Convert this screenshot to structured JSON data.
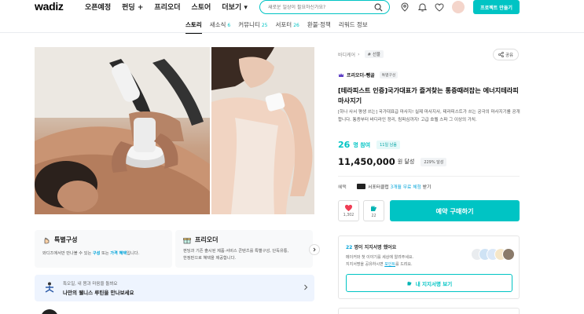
{
  "header": {
    "logo": "wadiz",
    "nav": [
      "오픈예정",
      "펀딩 +",
      "프리오더",
      "스토어",
      "더보기"
    ],
    "search_placeholder": "새로운 일상이 필요하신가요?",
    "project_button": "프로젝트 만들기",
    "icons": [
      "search-icon",
      "location-icon",
      "bell-icon",
      "heart-icon",
      "avatar"
    ]
  },
  "tabs": [
    {
      "label": "스토리",
      "count": "",
      "active": true
    },
    {
      "label": "새소식",
      "count": "6",
      "active": false
    },
    {
      "label": "커뮤니티",
      "count": "25",
      "active": false
    },
    {
      "label": "서포터",
      "count": "26",
      "active": false
    },
    {
      "label": "환불·정책",
      "count": "",
      "active": false
    },
    {
      "label": "리워드 정보",
      "count": "",
      "active": false
    }
  ],
  "features": {
    "special": {
      "title": "특별구성",
      "desc_pre": "와디즈에서만 만나볼 수 있는 ",
      "desc_hl1": "구성",
      "desc_mid": " 또는 ",
      "desc_hl2": "가격 혜택",
      "desc_post": "입니다."
    },
    "preorder": {
      "title": "프리오더",
      "desc_line1": "펀딩과 기존 출시된 제품·서비스 콘텐츠를 특별구성, 단독유통,",
      "desc_line2": "한정판으로 혜택을 제공합니다."
    }
  },
  "wellness": {
    "sub": "특오일, 내 몸과 마음을 돌봐요",
    "title": "나만의 웰니스 루틴을 만나보세요"
  },
  "product": {
    "breadcrumb": "바디케어",
    "tag": "# 선물",
    "share": "공유",
    "maker": "프리오더-뺑골",
    "maker_badge": "특별구성",
    "title": "[테라피스트 인증]국가대표가 즐겨찾는 통증때려잡는 에너지테라피 마사지기",
    "desc": "[하나 사서 평생 쓰는] 국가대표급 마사지! 실제 마사지사, 테라피스트가 쓰는 궁극의 마사지기를 공개합니다. 통증부터 바디라인 정리, 림퍼심까지! 고급 호텔 스파 그 이상의 가치.",
    "participants": "26",
    "participants_label": "명 참여",
    "days_left": "11일 남음",
    "amount": "11,450,000",
    "amount_label": "원 달성",
    "percent": "229% 달성",
    "benefit_label": "혜택",
    "benefit_text_pre": "서포터클럽 ",
    "benefit_text_hl": "3개월 무료 체험",
    "benefit_text_post": " 받기",
    "likes": "1,302",
    "supports": "22",
    "reserve_button": "예약 구매하기"
  },
  "signature": {
    "count": "22",
    "title_post": " 명이 지지서명 했어요",
    "desc_line1": "메이커와 첫 이야기를 세상에 알려주세요.",
    "desc_line2_pre": "지지서명을 공유하시면 ",
    "desc_line2_ul": "포인트",
    "desc_line2_post": "를 드려요.",
    "button": "내 지지서명 보기"
  },
  "colors": {
    "accent": "#00c4c4",
    "link": "#00a3d9"
  }
}
